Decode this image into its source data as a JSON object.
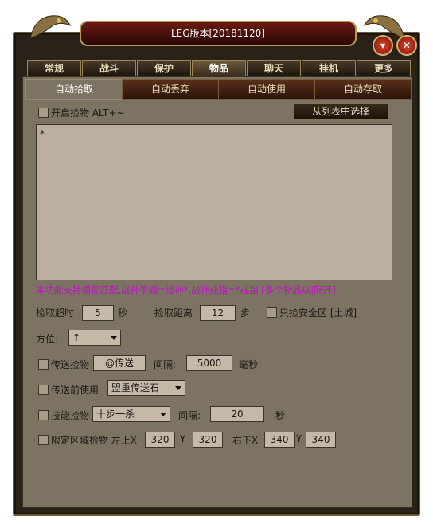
{
  "window": {
    "title": "LEG版本[20181120]"
  },
  "tabs_main": [
    "常规",
    "战斗",
    "保护",
    "物品",
    "聊天",
    "挂机",
    "更多"
  ],
  "tabs_main_active": 3,
  "tabs_sub": [
    "自动拾取",
    "自动丢弃",
    "自动使用",
    "自动存取"
  ],
  "tabs_sub_active": 0,
  "pickup": {
    "enable_label": "开启捡物 ALT+~",
    "select_from_list_label": "从列表中选择",
    "list_text": "*",
    "hint": "本功能支持模糊匹配,战神手镯=战神*,战神戒指=*戒指 [多个物品以|隔开]",
    "timeout_label": "捡取超时",
    "timeout_value": "5",
    "timeout_unit": "秒",
    "distance_label": "捡取距离",
    "distance_value": "12",
    "distance_unit": "步",
    "safe_zone_label": "只捡安全区 [土城]",
    "direction_label": "方位:",
    "direction_value": "↑",
    "send_label": "传送捡物",
    "send_button": "@传送",
    "interval_label": "间隔:",
    "interval_value": "5000",
    "interval_unit": "毫秒",
    "before_send_label": "传送前使用",
    "before_send_value": "盟重传送石",
    "skill_label": "技能捡物",
    "skill_value": "十步一杀",
    "skill_interval_label": "间隔:",
    "skill_interval_value": "20",
    "skill_interval_unit": "秒",
    "area_label": "限定区域捡物 左上X",
    "area_x1": "320",
    "area_y_label1": "Y",
    "area_y1": "320",
    "area_br_label": "右下X",
    "area_x2": "340",
    "area_y_label2": "Y",
    "area_y2": "340"
  },
  "icons": {
    "minimize": "chevron-down-icon",
    "close": "close-icon"
  }
}
